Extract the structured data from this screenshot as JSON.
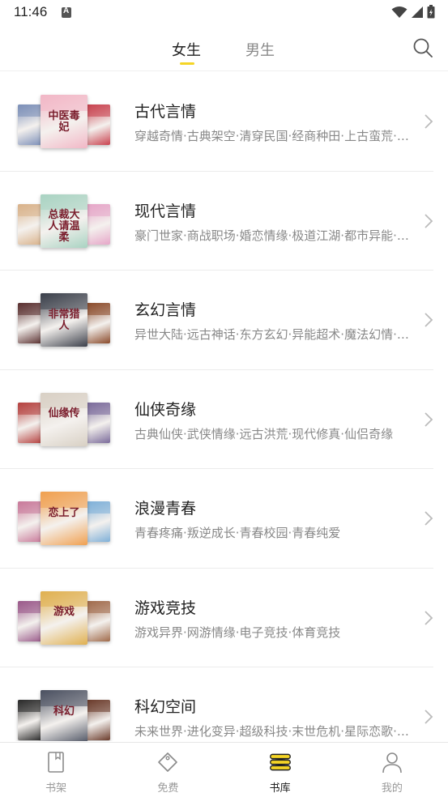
{
  "status_bar": {
    "time": "11:46"
  },
  "tabs": [
    {
      "label": "女生",
      "active": true
    },
    {
      "label": "男生",
      "active": false
    }
  ],
  "categories": [
    {
      "title": "古代言情",
      "subtitle": "穿越奇情·古典架空·清穿民国·经商种田·上古蛮荒·宫闱宅斗",
      "cover_text": "中医毒妃",
      "colors": [
        "#7c8fb8",
        "#f2b7c6",
        "#c9424f"
      ]
    },
    {
      "title": "现代言情",
      "subtitle": "豪门世家·商战职场·婚恋情缘·极道江湖·都市异能·娱乐明星",
      "cover_text": "总裁大人请温柔",
      "colors": [
        "#d9b28a",
        "#a9d3c2",
        "#e6a6c8"
      ]
    },
    {
      "title": "玄幻言情",
      "subtitle": "异世大陆·远古神话·东方玄幻·异能超术·魔法幻情·西方奇幻",
      "cover_text": "非常猎人",
      "colors": [
        "#5a3030",
        "#3b3f4a",
        "#8a4a2a"
      ]
    },
    {
      "title": "仙侠奇缘",
      "subtitle": "古典仙侠·武侠情缘·远古洪荒·现代修真·仙侣奇缘",
      "cover_text": "仙缘传",
      "colors": [
        "#b5413f",
        "#d8d0c4",
        "#7a6a9a"
      ]
    },
    {
      "title": "浪漫青春",
      "subtitle": "青春疼痛·叛逆成长·青春校园·青春纯爱",
      "cover_text": "恋上了",
      "colors": [
        "#c97a9a",
        "#f0a050",
        "#7fb0d8"
      ]
    },
    {
      "title": "游戏竞技",
      "subtitle": "游戏异界·网游情缘·电子竞技·体育竞技",
      "cover_text": "游戏",
      "colors": [
        "#9a5a8a",
        "#e0b050",
        "#a06a4a"
      ]
    },
    {
      "title": "科幻空间",
      "subtitle": "未来世界·进化变异·超级科技·末世危机·星际恋歌·时空穿梭",
      "cover_text": "科幻",
      "colors": [
        "#2a2a2a",
        "#4a5060",
        "#6a3a2a"
      ]
    }
  ],
  "bottom_nav": [
    {
      "label": "书架",
      "icon": "bookshelf-icon",
      "active": false
    },
    {
      "label": "免费",
      "icon": "tag-icon",
      "active": false
    },
    {
      "label": "书库",
      "icon": "library-icon",
      "active": true
    },
    {
      "label": "我的",
      "icon": "profile-icon",
      "active": false
    }
  ],
  "colors": {
    "accent": "#f5d526",
    "text_primary": "#222222",
    "text_secondary": "#888888",
    "divider": "#ececec"
  }
}
